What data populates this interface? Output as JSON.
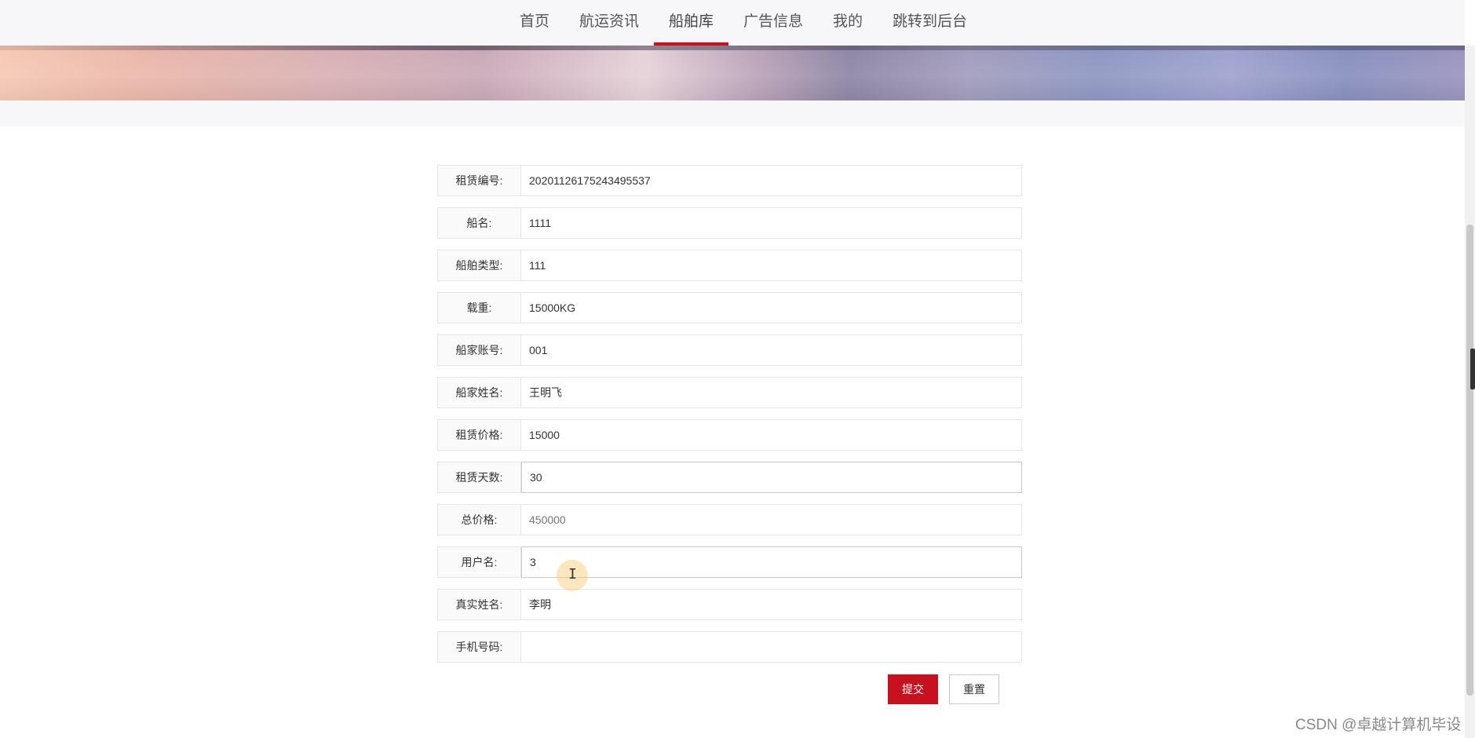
{
  "nav": {
    "items": [
      {
        "label": "首页"
      },
      {
        "label": "航运资讯"
      },
      {
        "label": "船舶库"
      },
      {
        "label": "广告信息"
      },
      {
        "label": "我的"
      },
      {
        "label": "跳转到后台"
      }
    ],
    "active": "船舶库"
  },
  "form": {
    "fields": [
      {
        "label": "租赁编号:",
        "value": "20201126175243495537"
      },
      {
        "label": "船名:",
        "value": "1111"
      },
      {
        "label": "船舶类型:",
        "value": "111"
      },
      {
        "label": "载重:",
        "value": "15000KG"
      },
      {
        "label": "船家账号:",
        "value": "001"
      },
      {
        "label": "船家姓名:",
        "value": "王明飞"
      },
      {
        "label": "租赁价格:",
        "value": "15000"
      },
      {
        "label": "租赁天数:",
        "value": "30"
      },
      {
        "label": "总价格:",
        "value": "450000"
      },
      {
        "label": "用户名:",
        "value": "3"
      },
      {
        "label": "真实姓名:",
        "value": "李明"
      },
      {
        "label": "手机号码:",
        "value": ""
      }
    ]
  },
  "buttons": {
    "submit": "提交",
    "reset": "重置"
  },
  "watermark": "CSDN @卓越计算机毕设",
  "colors": {
    "accent": "#c8101f"
  }
}
